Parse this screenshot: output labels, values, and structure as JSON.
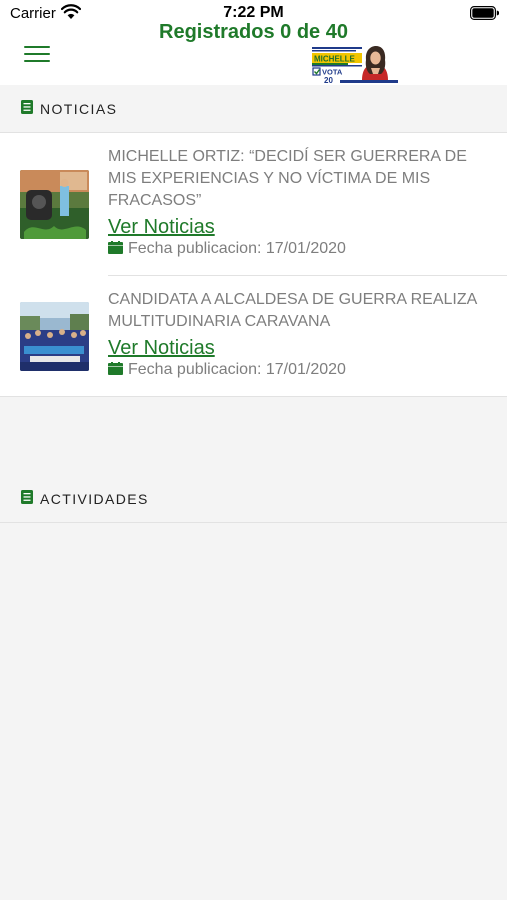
{
  "status_bar": {
    "carrier": "Carrier",
    "time": "7:22 PM"
  },
  "header": {
    "title": "Registrados 0 de 40",
    "logo": {
      "name_text": "MICHELLE",
      "vote_text": "VOTA",
      "number": "20"
    }
  },
  "sections": {
    "news": {
      "label": "NOTICIAS"
    },
    "activities": {
      "label": "ACTIVIDADES"
    }
  },
  "news": [
    {
      "title": "MICHELLE ORTIZ: “DECIDÍ SER GUERRERA DE MIS EXPERIENCIAS Y NO VÍCTIMA DE MIS FRACASOS”",
      "link_label": "Ver Noticias",
      "date": "Fecha publicacion: 17/01/2020"
    },
    {
      "title": "CANDIDATA A ALCALDESA DE GUERRA REALIZA MULTITUDINARIA CARAVANA",
      "link_label": "Ver Noticias",
      "date": "Fecha publicacion: 17/01/2020"
    }
  ],
  "colors": {
    "brand_green": "#1f7a2a",
    "muted_text": "#7e7e7e",
    "background": "#f4f4f4"
  },
  "icons": {
    "menu": "hamburger-menu-icon",
    "section": "book-icon",
    "date": "calendar-icon"
  }
}
